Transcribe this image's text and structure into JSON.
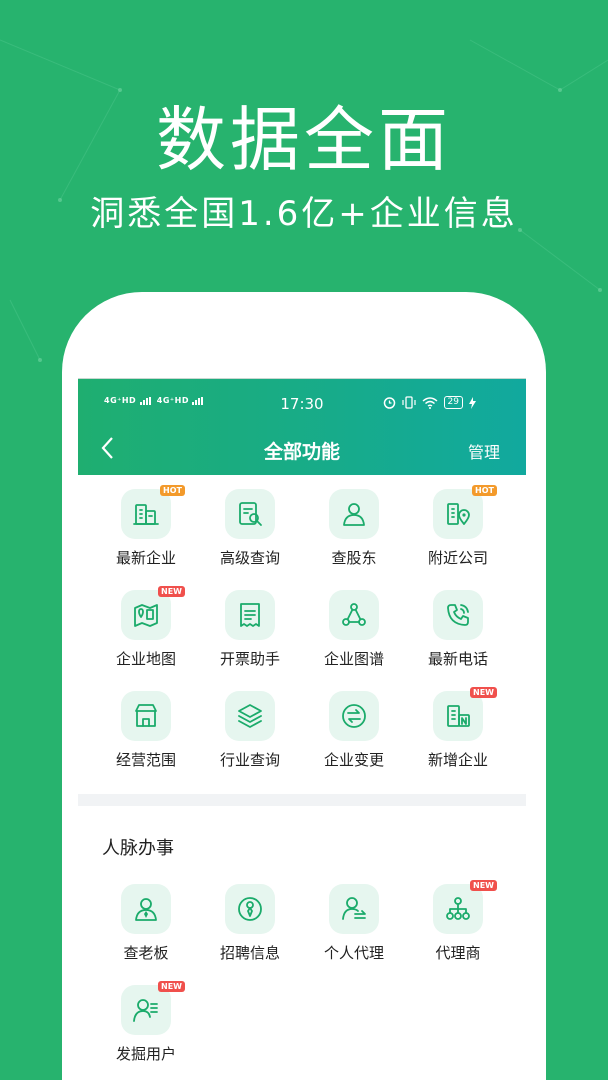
{
  "promo": {
    "headline": "数据全面",
    "subline": "洞悉全国1.6亿+企业信息"
  },
  "status_bar": {
    "signal_1": "4G⁺HD",
    "signal_2": "4G⁺HD",
    "time": "17:30",
    "battery": "29"
  },
  "nav": {
    "title": "全部功能",
    "manage_label": "管理"
  },
  "colors": {
    "background": "#27b36e",
    "header_start": "#1fae70",
    "header_end": "#11a99e",
    "icon_stroke": "#1bab6b",
    "hot_badge": "#f39a2b",
    "new_badge": "#f0504c"
  },
  "features": [
    {
      "label": "最新企业",
      "icon": "building-icon",
      "badge": "HOT",
      "badge_type": "hot"
    },
    {
      "label": "高级查询",
      "icon": "document-search-icon",
      "badge": "",
      "badge_type": ""
    },
    {
      "label": "查股东",
      "icon": "person-icon",
      "badge": "",
      "badge_type": ""
    },
    {
      "label": "附近公司",
      "icon": "building-location-icon",
      "badge": "HOT",
      "badge_type": "hot"
    },
    {
      "label": "企业地图",
      "icon": "map-icon",
      "badge": "NEW",
      "badge_type": "new"
    },
    {
      "label": "开票助手",
      "icon": "invoice-icon",
      "badge": "",
      "badge_type": ""
    },
    {
      "label": "企业图谱",
      "icon": "graph-icon",
      "badge": "",
      "badge_type": ""
    },
    {
      "label": "最新电话",
      "icon": "phone-icon",
      "badge": "",
      "badge_type": ""
    },
    {
      "label": "经营范围",
      "icon": "shop-icon",
      "badge": "",
      "badge_type": ""
    },
    {
      "label": "行业查询",
      "icon": "layers-icon",
      "badge": "",
      "badge_type": ""
    },
    {
      "label": "企业变更",
      "icon": "exchange-icon",
      "badge": "",
      "badge_type": ""
    },
    {
      "label": "新增企业",
      "icon": "new-building-icon",
      "badge": "NEW",
      "badge_type": "new"
    }
  ],
  "network_section": {
    "title": "人脉办事",
    "items": [
      {
        "label": "查老板",
        "icon": "boss-icon",
        "badge": "",
        "badge_type": ""
      },
      {
        "label": "招聘信息",
        "icon": "recruit-icon",
        "badge": "",
        "badge_type": ""
      },
      {
        "label": "个人代理",
        "icon": "agent-icon",
        "badge": "",
        "badge_type": ""
      },
      {
        "label": "代理商",
        "icon": "org-chart-icon",
        "badge": "NEW",
        "badge_type": "new"
      },
      {
        "label": "发掘用户",
        "icon": "user-list-icon",
        "badge": "NEW",
        "badge_type": "new"
      }
    ]
  }
}
